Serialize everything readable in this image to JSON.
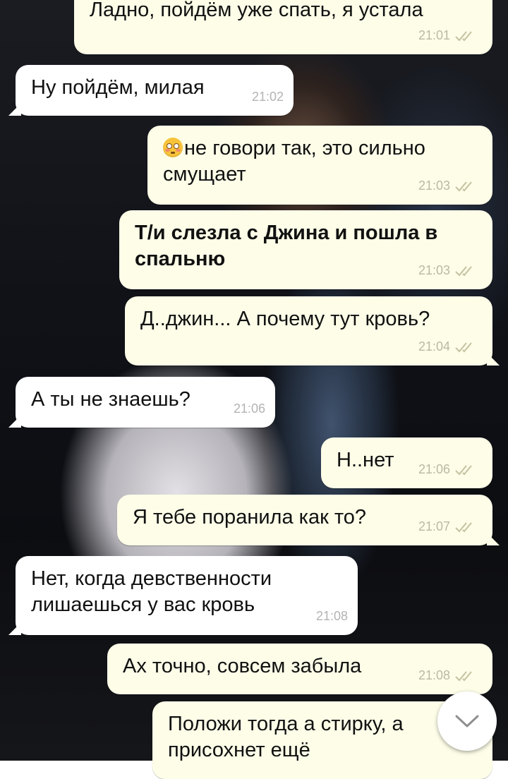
{
  "messages": [
    {
      "text": "Ладно, пойдём уже спать, я устала",
      "time": "21:01",
      "direction": "out",
      "status": "read"
    },
    {
      "text": "Ну пойдём, милая",
      "time": "21:02",
      "direction": "in"
    },
    {
      "text": "не говори так, это сильно смущает",
      "time": "21:03",
      "direction": "out",
      "status": "read",
      "emoji": "flushed-face"
    },
    {
      "text": "Т/и слезла с Джина и пошла в спальню",
      "time": "21:03",
      "direction": "out",
      "status": "read",
      "bold": true
    },
    {
      "text": "Д..джин... А почему тут кровь?",
      "time": "21:04",
      "direction": "out",
      "status": "read"
    },
    {
      "text": "А ты не знаешь?",
      "time": "21:06",
      "direction": "in"
    },
    {
      "text": "Н..нет",
      "time": "21:06",
      "direction": "out",
      "status": "read"
    },
    {
      "text": "Я тебе поранила как то?",
      "time": "21:07",
      "direction": "out",
      "status": "read"
    },
    {
      "text": "Нет, когда девственности лишаешься у вас кровь",
      "time": "21:08",
      "direction": "in"
    },
    {
      "text": "Ах точно, совсем забыла",
      "time": "21:08",
      "direction": "out",
      "status": "read"
    },
    {
      "text": "Положи тогда а стирку, а\nприсохнет ещё",
      "time": "",
      "direction": "out",
      "status": "read"
    }
  ],
  "colors": {
    "incoming_bubble": "#ffffff",
    "outgoing_bubble": "#fdfde8",
    "tick": "#c4c2a0"
  },
  "scroll_button_icon": "chevron-down-icon"
}
